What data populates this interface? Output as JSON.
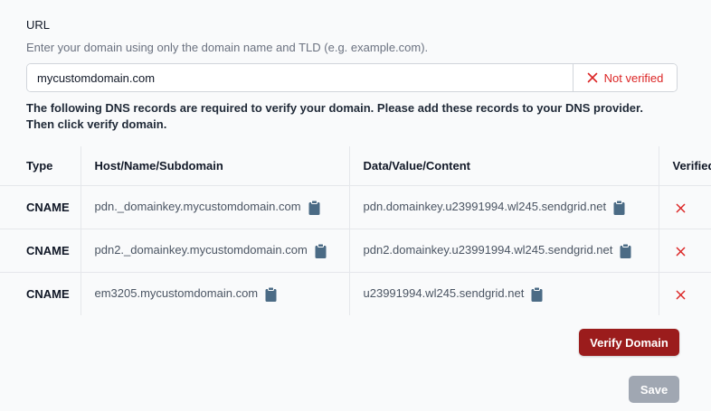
{
  "url": {
    "label": "URL",
    "help": "Enter your domain using only the domain name and TLD (e.g. example.com).",
    "value": "mycustomdomain.com",
    "status": "Not verified",
    "status_color": "#dc2626"
  },
  "instructions": "The following DNS records are required to verify your domain. Please add these records to your DNS provider. Then click verify domain.",
  "table": {
    "headers": [
      "Type",
      "Host/Name/Subdomain",
      "Data/Value/Content",
      "Verified"
    ],
    "rows": [
      {
        "type": "CNAME",
        "host": "pdn._domainkey.mycustomdomain.com",
        "data": "pdn.domainkey.u23991994.wl245.sendgrid.net"
      },
      {
        "type": "CNAME",
        "host": "pdn2._domainkey.mycustomdomain.com",
        "data": "pdn2.domainkey.u23991994.wl245.sendgrid.net"
      },
      {
        "type": "CNAME",
        "host": "em3205.mycustomdomain.com",
        "data": "u23991994.wl245.sendgrid.net"
      }
    ]
  },
  "icons": {
    "copy": "clipboard-icon",
    "unverified": "x-icon"
  },
  "buttons": {
    "verify": "Verify Domain",
    "save": "Save"
  },
  "colors": {
    "verify_bg": "#9b1c1c",
    "save_bg": "#9ca3af",
    "icon_blue": "#4b6b85"
  }
}
